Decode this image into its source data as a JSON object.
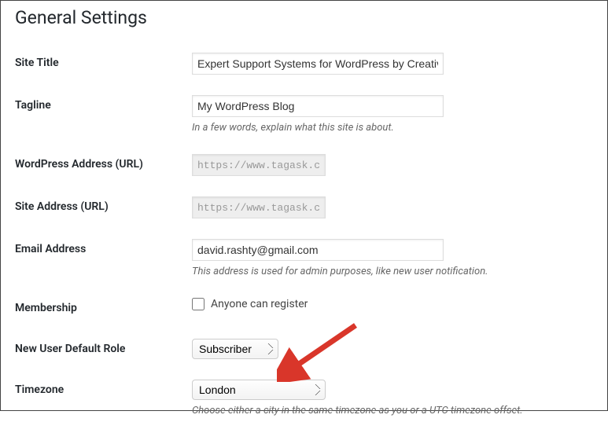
{
  "page_title": "General Settings",
  "fields": {
    "site_title": {
      "label": "Site Title",
      "value": "Expert Support Systems for WordPress by Creative"
    },
    "tagline": {
      "label": "Tagline",
      "value": "My WordPress Blog",
      "description": "In a few words, explain what this site is about."
    },
    "wp_address": {
      "label": "WordPress Address (URL)",
      "value": "https://www.tagask.com"
    },
    "site_address": {
      "label": "Site Address (URL)",
      "value": "https://www.tagask.com"
    },
    "email": {
      "label": "Email Address",
      "value": "david.rashty@gmail.com",
      "description": "This address is used for admin purposes, like new user notification."
    },
    "membership": {
      "label": "Membership",
      "checkbox_label": "Anyone can register"
    },
    "default_role": {
      "label": "New User Default Role",
      "value": "Subscriber"
    },
    "timezone": {
      "label": "Timezone",
      "value": "London",
      "description": "Choose either a city in the same timezone as you or a UTC timezone offset."
    }
  }
}
